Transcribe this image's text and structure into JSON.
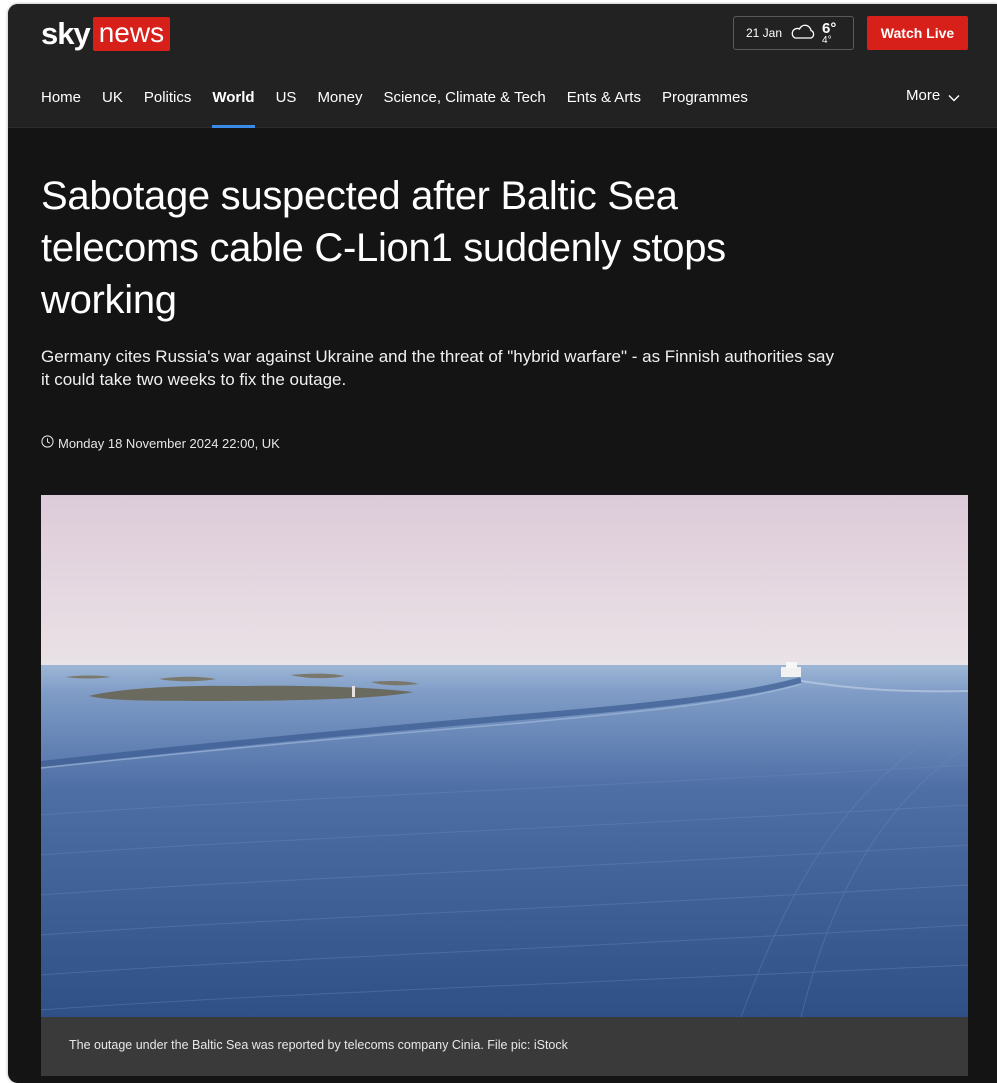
{
  "brand": {
    "logo_sky": "sky",
    "logo_news": "news"
  },
  "header": {
    "weather": {
      "date": "21 Jan",
      "icon": "cloud-icon",
      "high": "6°",
      "low": "4°"
    },
    "watch_live_label": "Watch Live"
  },
  "nav": {
    "items": [
      {
        "label": "Home"
      },
      {
        "label": "UK"
      },
      {
        "label": "Politics"
      },
      {
        "label": "World",
        "active": true
      },
      {
        "label": "US"
      },
      {
        "label": "Money"
      },
      {
        "label": "Science, Climate & Tech"
      },
      {
        "label": "Ents & Arts"
      },
      {
        "label": "Programmes"
      }
    ],
    "more_label": "More"
  },
  "article": {
    "headline": "Sabotage suspected after Baltic Sea telecoms cable C-Lion1 suddenly stops working",
    "standfirst": "Germany cites Russia's war against Ukraine and the threat of \"hybrid warfare\" - as Finnish authorities say it could take two weeks to fix the outage.",
    "timestamp": "Monday 18 November 2024 22:00, UK",
    "image_caption": "The outage under the Baltic Sea was reported by telecoms company Cinia. File pic: iStock"
  },
  "colors": {
    "brand_red": "#d8201a",
    "nav_active_underline": "#3b8be8",
    "page_background": "#141414"
  }
}
